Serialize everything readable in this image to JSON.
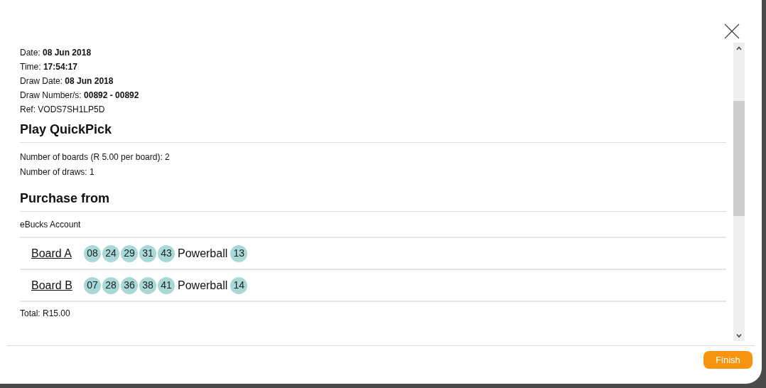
{
  "details": [
    "Date: **08 Jun 2018**",
    "Time: **17:54:17**",
    "Draw Date: **08 Jun 2018**",
    "Draw Number/s: **00892 - 00892**",
    "Ref: VODS7SH1LP5D"
  ],
  "play": {
    "heading": "Play QuickPick",
    "lines": [
      "Number of boards (R 5.00 per board): 2",
      "Number of draws: 1"
    ]
  },
  "purchase": {
    "heading": "Purchase from",
    "account": "eBucks Account"
  },
  "boards": [
    {
      "label": "Board A",
      "numbers": [
        "08",
        "24",
        "29",
        "31",
        "43"
      ],
      "powerball_label": "Powerball",
      "powerball": "13"
    },
    {
      "label": "Board B",
      "numbers": [
        "07",
        "28",
        "36",
        "38",
        "41"
      ],
      "powerball_label": "Powerball",
      "powerball": "14"
    }
  ],
  "total": "Total: R15.00",
  "finish_button": "Finish"
}
